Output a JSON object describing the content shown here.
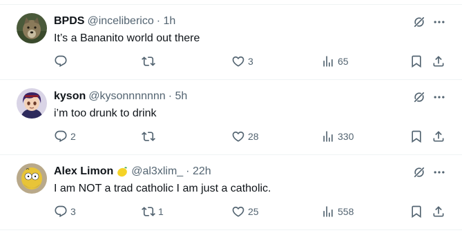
{
  "tweets": [
    {
      "name": "BPDS",
      "handle": "@inceliberico",
      "time": "· 1h",
      "text": "It’s a Bananito world out there",
      "replies": "",
      "reposts": "",
      "likes": "3",
      "views": "65",
      "avatar": "wolf-avatar"
    },
    {
      "name": "kyson",
      "handle": "@kysonnnnnnn",
      "time": "· 5h",
      "text": "i’m too drunk to drink",
      "replies": "2",
      "reposts": "",
      "likes": "28",
      "views": "330",
      "avatar": "anime-character-avatar"
    },
    {
      "name": "Alex Limon",
      "handle": "@al3xlim_",
      "time": "· 22h",
      "text": "I am NOT a trad catholic I am just a catholic.",
      "replies": "3",
      "reposts": "1",
      "likes": "25",
      "views": "558",
      "avatar": "homer-simpson-avatar",
      "name_emoji": "lemon-emoji"
    }
  ],
  "colors": {
    "text": "#0f1419",
    "secondary": "#536471",
    "divider": "#eff3f4"
  }
}
